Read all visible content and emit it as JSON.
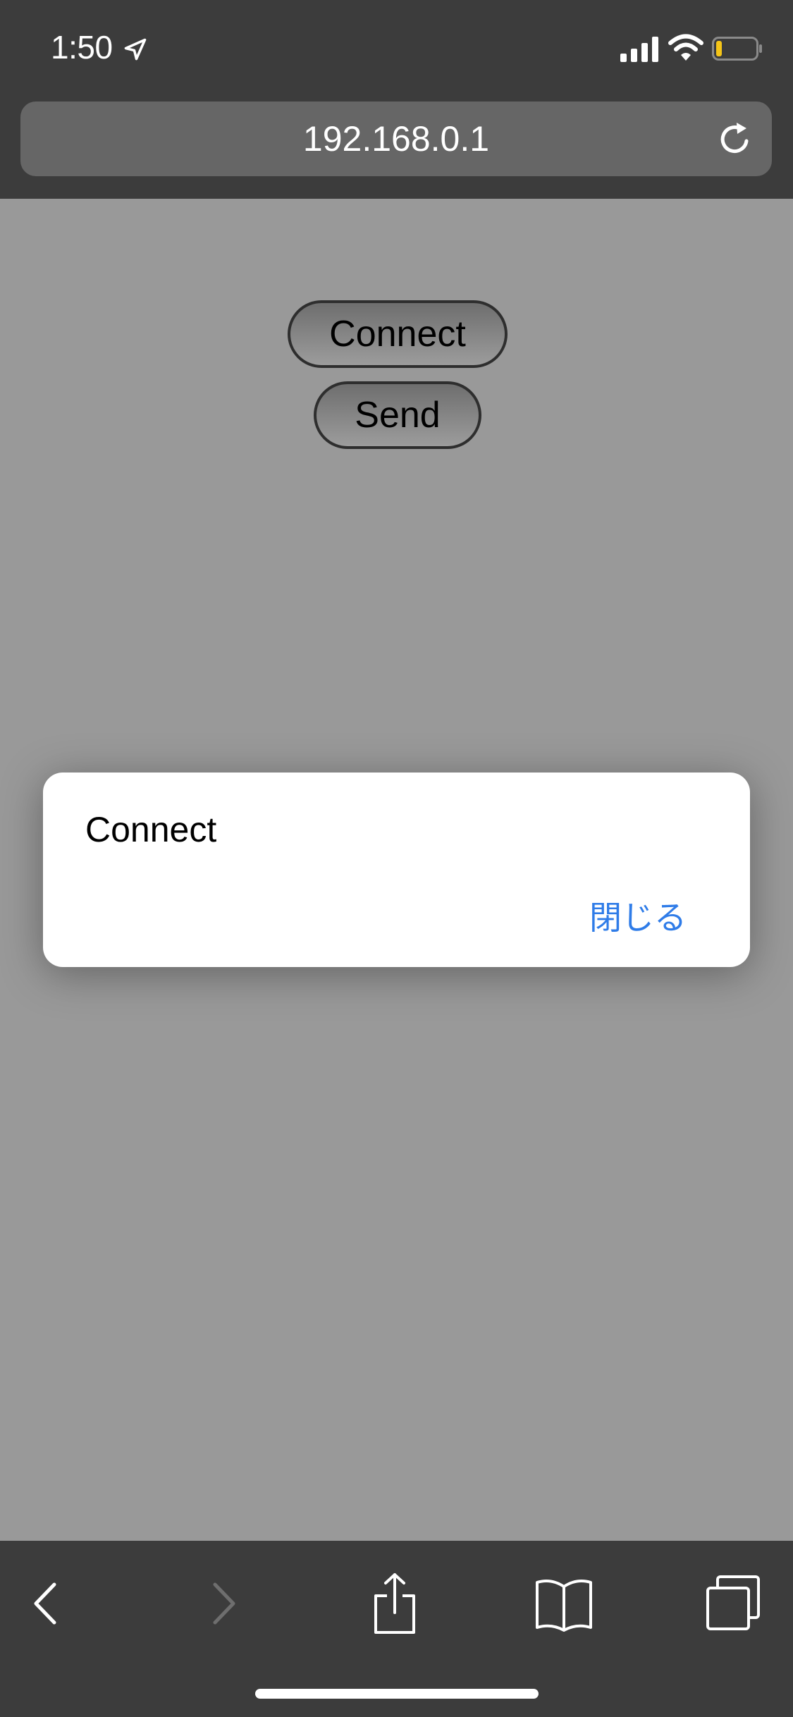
{
  "status_bar": {
    "time": "1:50",
    "icons": [
      "location-arrow-icon",
      "cellular-signal-icon",
      "wifi-icon",
      "battery-icon"
    ],
    "battery_level_fraction": 0.15,
    "battery_color": "#f5c518"
  },
  "address_bar": {
    "url": "192.168.0.1",
    "reload_icon": "reload-icon"
  },
  "page": {
    "background_color": "#999999",
    "buttons": {
      "connect_label": "Connect",
      "send_label": "Send"
    }
  },
  "alert": {
    "message": "Connect",
    "close_label": "閉じる",
    "close_color": "#2f7ce8"
  },
  "toolbar": {
    "icons": [
      "back-icon",
      "forward-icon",
      "share-icon",
      "bookmarks-icon",
      "tabs-icon"
    ]
  }
}
